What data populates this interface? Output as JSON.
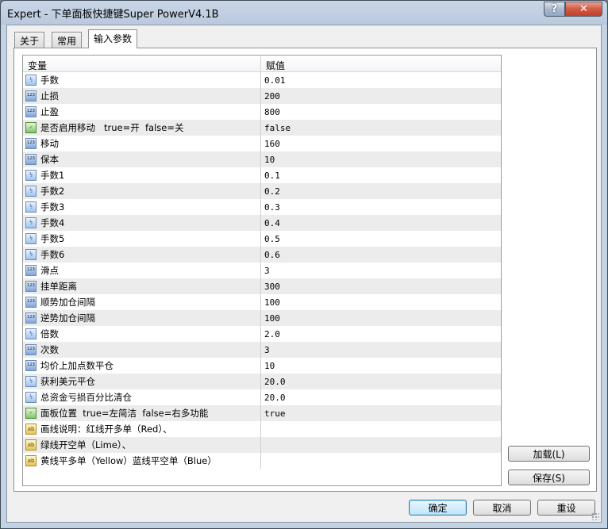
{
  "window": {
    "title": "Expert - 下单面板快捷键Super PowerV4.1B"
  },
  "tabs": [
    {
      "label": "关于"
    },
    {
      "label": "常用"
    },
    {
      "label": "输入参数"
    }
  ],
  "grid": {
    "headers": {
      "variable": "变量",
      "value": "赋值"
    },
    "rows": [
      {
        "icon": "double-icon",
        "variable": "手数",
        "value": "0.01"
      },
      {
        "icon": "integer-icon",
        "variable": "止损",
        "value": "200"
      },
      {
        "icon": "integer-icon",
        "variable": "止盈",
        "value": "800"
      },
      {
        "icon": "bool-icon",
        "variable": "是否启用移动   true=开  false=关",
        "value": "false"
      },
      {
        "icon": "integer-icon",
        "variable": "移动",
        "value": "160"
      },
      {
        "icon": "integer-icon",
        "variable": "保本",
        "value": "10"
      },
      {
        "icon": "double-icon",
        "variable": "手数1",
        "value": "0.1"
      },
      {
        "icon": "double-icon",
        "variable": "手数2",
        "value": "0.2"
      },
      {
        "icon": "double-icon",
        "variable": "手数3",
        "value": "0.3"
      },
      {
        "icon": "double-icon",
        "variable": "手数4",
        "value": "0.4"
      },
      {
        "icon": "double-icon",
        "variable": "手数5",
        "value": "0.5"
      },
      {
        "icon": "double-icon",
        "variable": "手数6",
        "value": "0.6"
      },
      {
        "icon": "integer-icon",
        "variable": "滑点",
        "value": "3"
      },
      {
        "icon": "integer-icon",
        "variable": "挂单距离",
        "value": "300"
      },
      {
        "icon": "integer-icon",
        "variable": "顺势加仓间隔",
        "value": "100"
      },
      {
        "icon": "integer-icon",
        "variable": "逆势加仓间隔",
        "value": "100"
      },
      {
        "icon": "double-icon",
        "variable": "倍数",
        "value": "2.0"
      },
      {
        "icon": "integer-icon",
        "variable": "次数",
        "value": "3"
      },
      {
        "icon": "integer-icon",
        "variable": "均价上加点数平仓",
        "value": "10"
      },
      {
        "icon": "double-icon",
        "variable": "获利美元平仓",
        "value": "20.0"
      },
      {
        "icon": "double-icon",
        "variable": "总资金亏损百分比清仓",
        "value": "20.0"
      },
      {
        "icon": "bool-icon",
        "variable": "面板位置  true=左简洁  false=右多功能",
        "value": "true"
      },
      {
        "icon": "string-icon",
        "variable": "画线说明：红线开多单（Red）、",
        "value": ""
      },
      {
        "icon": "string-icon",
        "variable": "绿线开空单（Lime）、",
        "value": ""
      },
      {
        "icon": "string-icon",
        "variable": "黄线平多单（Yellow）蓝线平空单（Blue）",
        "value": ""
      }
    ]
  },
  "buttons": {
    "load": "加载(L)",
    "save": "保存(S)",
    "ok": "确定",
    "cancel": "取消",
    "reset": "重设"
  },
  "icon_glyphs": {
    "help": "?",
    "close": "✕",
    "double": "½",
    "integer": "123",
    "bool": "✓",
    "string": "ab"
  }
}
